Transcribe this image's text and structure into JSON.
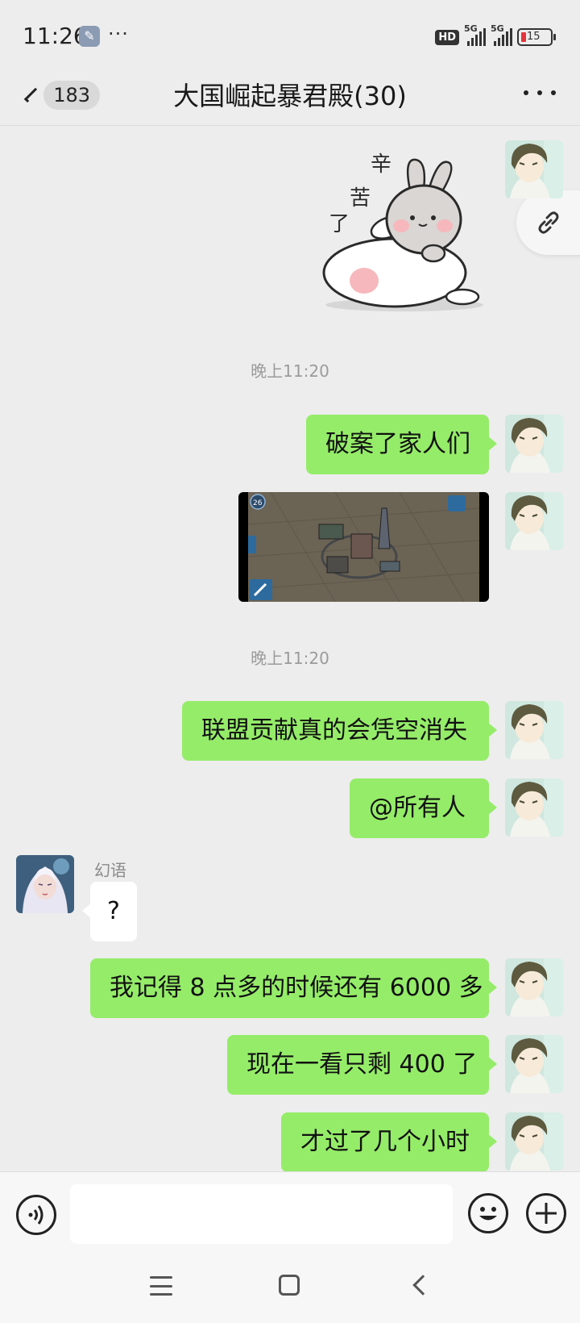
{
  "status_bar": {
    "time": "11:26",
    "dots": "···",
    "hd_label": "HD",
    "signal_1_label": "5G",
    "signal_2_label": "5G",
    "battery": "15"
  },
  "header": {
    "unread_count": "183",
    "title": "大国崛起暴君殿(30)"
  },
  "sticker": {
    "text_1": "辛",
    "text_2": "苦",
    "text_3": "了"
  },
  "messages": {
    "ts_1": "晚上11:20",
    "m1": "破案了家人们",
    "ts_2": "晚上11:20",
    "m2": "联盟贡献真的会凭空消失",
    "m3": "@所有人",
    "sender_name": "幻语",
    "m4": "?",
    "m5": "我记得 8 点多的时候还有 6000 多",
    "m6": "现在一看只剩 400 了",
    "m7": "才过了几个小时"
  },
  "game_screenshot": {
    "level": "26"
  },
  "input": {
    "placeholder": ""
  },
  "colors": {
    "self_bubble": "#95ec69",
    "other_bubble": "#ffffff",
    "background": "#ededed"
  }
}
